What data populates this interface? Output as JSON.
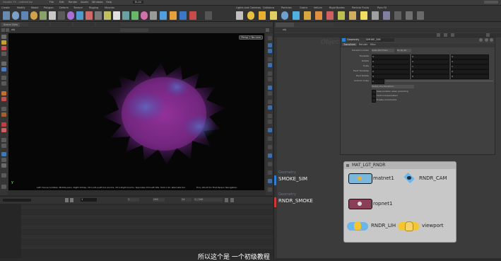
{
  "window": {
    "title": "Houdini FX - untitled.hip",
    "menus": [
      "File",
      "Edit",
      "Render",
      "Assets",
      "Windows",
      "Help"
    ],
    "desktop": "Build"
  },
  "left_shelf": {
    "tabs": [
      "Create",
      "Modify",
      "Model",
      "Polygon",
      "Deform",
      "Texture",
      "Rigging",
      "Muscles"
    ]
  },
  "right_shelf": {
    "tabs": [
      "Lights and Cameras",
      "Collisions",
      "Particles",
      "Grains",
      "Vellum",
      "Rigid Bodies",
      "Particle Fluids",
      "Pyro FX"
    ]
  },
  "scene_view": {
    "tab": "Scene View",
    "path": "obj",
    "view_mode": "Persp",
    "camera": "No cam",
    "status_line": "Left mouse tumbles. Middle pans. Right dollies. Ctrl+Alt+Left box-zooms. Ctrl+Right zooms. Spacebar-Ctrl-Left tilts. Hold L for alternate tumble, dolly, and zoom.",
    "status_right": "M or Alt+M for First Person Navigation.",
    "axis": "y"
  },
  "param_pane": {
    "tab": "Parameters",
    "node_type": "Geometry",
    "node_name": "SMOKE_SIM",
    "tabs": [
      "Transform",
      "Render",
      "Misc"
    ],
    "active_tab": "Transform",
    "rows": [
      {
        "label": "Transform Order",
        "v1": "Scale Rot Trans",
        "v2": "Rx Ry Rz"
      },
      {
        "label": "Translate",
        "v1": "0",
        "v2": "0",
        "v3": "0"
      },
      {
        "label": "Rotate",
        "v1": "0",
        "v2": "0",
        "v3": "0"
      },
      {
        "label": "Scale",
        "v1": "1",
        "v2": "1",
        "v3": "1"
      },
      {
        "label": "Pivot Translate",
        "v1": "0",
        "v2": "0",
        "v3": "0"
      },
      {
        "label": "Pivot Rotate",
        "v1": "0",
        "v2": "0",
        "v3": "0"
      },
      {
        "label": "Uniform Scale",
        "v1": "1"
      }
    ],
    "dropdown": "Modify Pre-Transform",
    "checks": [
      "Keep position when parenting",
      "Child Compensation",
      "Enable Constraints"
    ]
  },
  "network": {
    "tab": "obj",
    "context_label": "Objects",
    "nodes": [
      {
        "type": "Geometry",
        "name": "SMOKE_SIM",
        "color": "#2f7fd0"
      },
      {
        "type": "Geometry",
        "name": "RNDR_SMOKE",
        "color": "#d23535"
      }
    ],
    "subnet": {
      "title": "MAT_LGT_RNDR",
      "nodes": [
        {
          "name": "matnet1"
        },
        {
          "name": "RNDR_CAM"
        },
        {
          "name": "ropnet1"
        },
        {
          "name": "RNDR_LIH"
        },
        {
          "name": "viewport"
        }
      ]
    }
  },
  "timeline": {
    "frame": "1",
    "start": "1",
    "end": "240",
    "fps": "24",
    "range": "1 | 240"
  },
  "subtitle": "所以这个是 一个初级教程"
}
